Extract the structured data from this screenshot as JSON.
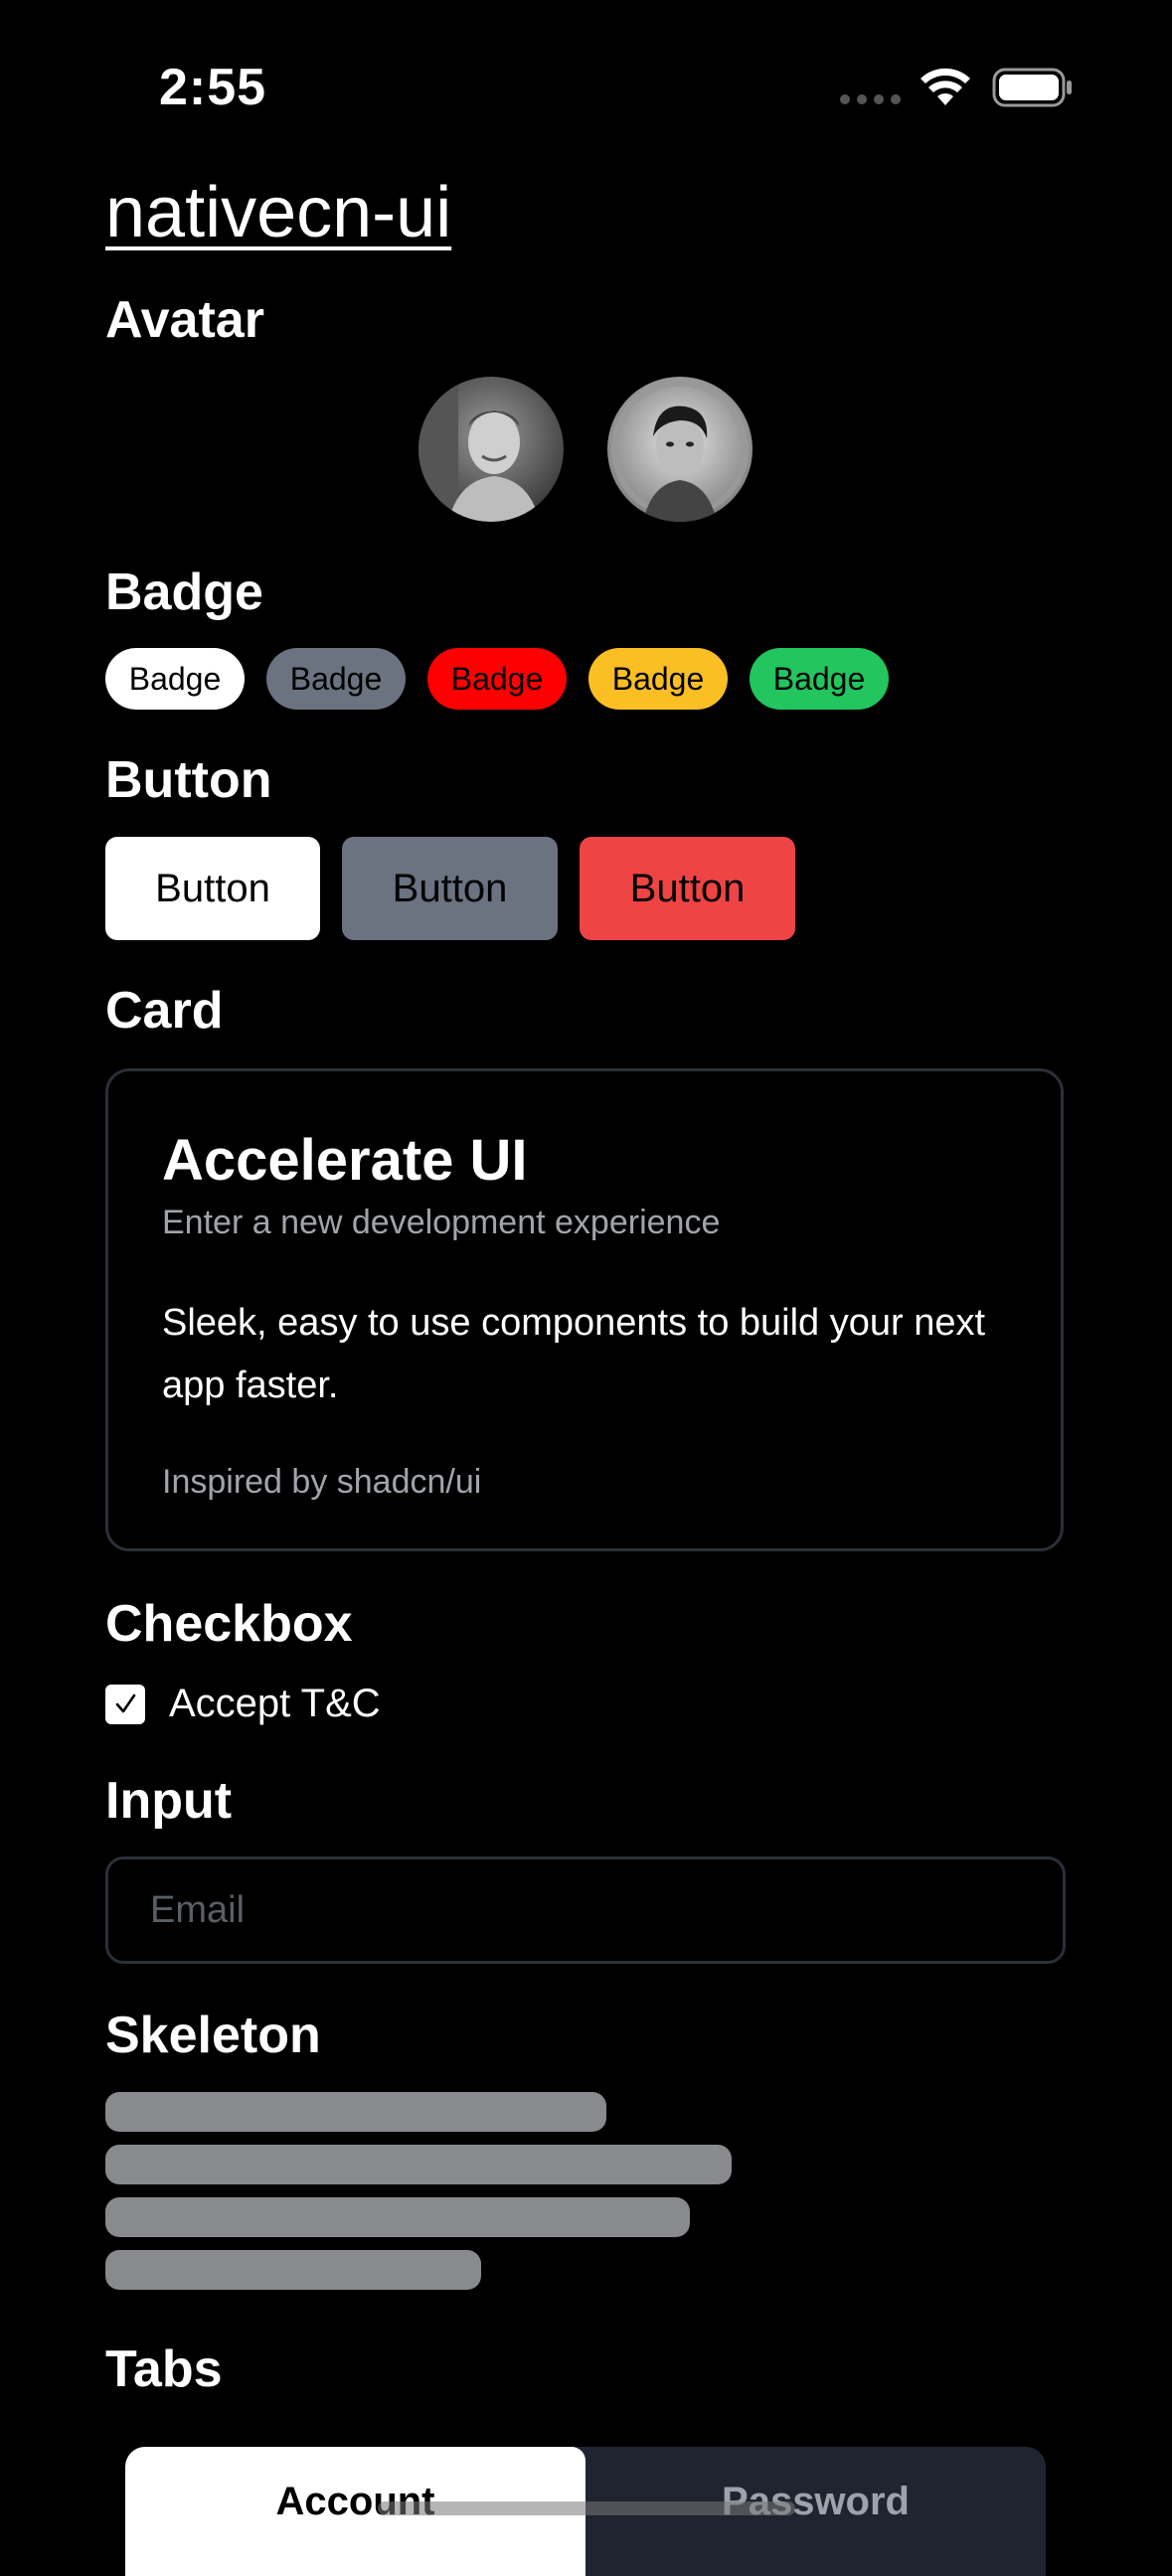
{
  "status_bar": {
    "time": "2:55"
  },
  "app": {
    "title": "nativecn-ui"
  },
  "sections": {
    "avatar": "Avatar",
    "badge": "Badge",
    "button": "Button",
    "card": "Card",
    "checkbox": "Checkbox",
    "input": "Input",
    "skeleton": "Skeleton",
    "tabs": "Tabs"
  },
  "badges": [
    {
      "label": "Badge",
      "color": "#ffffff"
    },
    {
      "label": "Badge",
      "color": "#6b7280"
    },
    {
      "label": "Badge",
      "color": "#ff0000"
    },
    {
      "label": "Badge",
      "color": "#fbbf24"
    },
    {
      "label": "Badge",
      "color": "#22c55e"
    }
  ],
  "buttons": [
    {
      "label": "Button",
      "color": "#ffffff"
    },
    {
      "label": "Button",
      "color": "#6b7280"
    },
    {
      "label": "Button",
      "color": "#ef4444"
    }
  ],
  "card": {
    "title": "Accelerate UI",
    "description": "Enter a new development experience",
    "body": "Sleek, easy to use components to build your next app faster.",
    "footer": "Inspired by shadcn/ui"
  },
  "checkbox": {
    "label": "Accept T&C",
    "checked": true
  },
  "input": {
    "placeholder": "Email",
    "value": ""
  },
  "tabs": {
    "items": [
      {
        "label": "Account",
        "active": true
      },
      {
        "label": "Password",
        "active": false
      }
    ]
  },
  "icons": {
    "wifi": "wifi-icon",
    "battery": "battery-icon",
    "check": "check-icon"
  }
}
